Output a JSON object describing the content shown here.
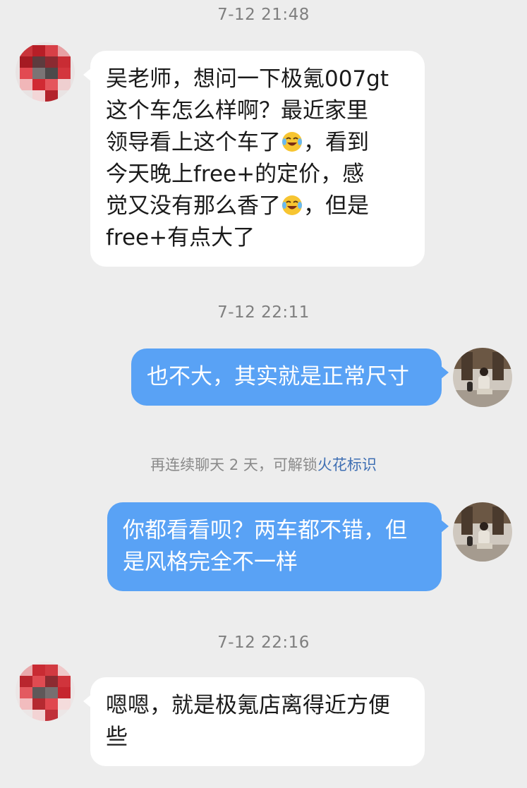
{
  "timestamps": [
    "7-12 21:48",
    "7-12 22:11",
    "7-12 22:16"
  ],
  "system_notice": {
    "text": "再连续聊天 2 天，可解锁",
    "link": "火花标识"
  },
  "messages": [
    {
      "side": "incoming",
      "parts": [
        "吴老师，想问一下极氪007gt\n这个车怎么样啊？最近家里\n领导看上这个车了",
        "[laughing-crying-emoji]",
        "，看到\n今天晚上free+的定价，感\n觉又没有那么香了",
        "[laughing-crying-emoji]",
        "，但是\nfree+有点大了"
      ]
    },
    {
      "side": "outgoing",
      "text": "也不大，其实就是正常尺寸"
    },
    {
      "side": "outgoing",
      "text": "你都看看呗？两车都不错，但\n是风格完全不一样"
    },
    {
      "side": "incoming",
      "text": "嗯嗯，就是极氪店离得近方便\n些"
    }
  ],
  "colors": {
    "background": "#ededed",
    "incoming_bubble": "#ffffff",
    "outgoing_bubble": "#59a2f5",
    "link": "#3f6fb3"
  }
}
